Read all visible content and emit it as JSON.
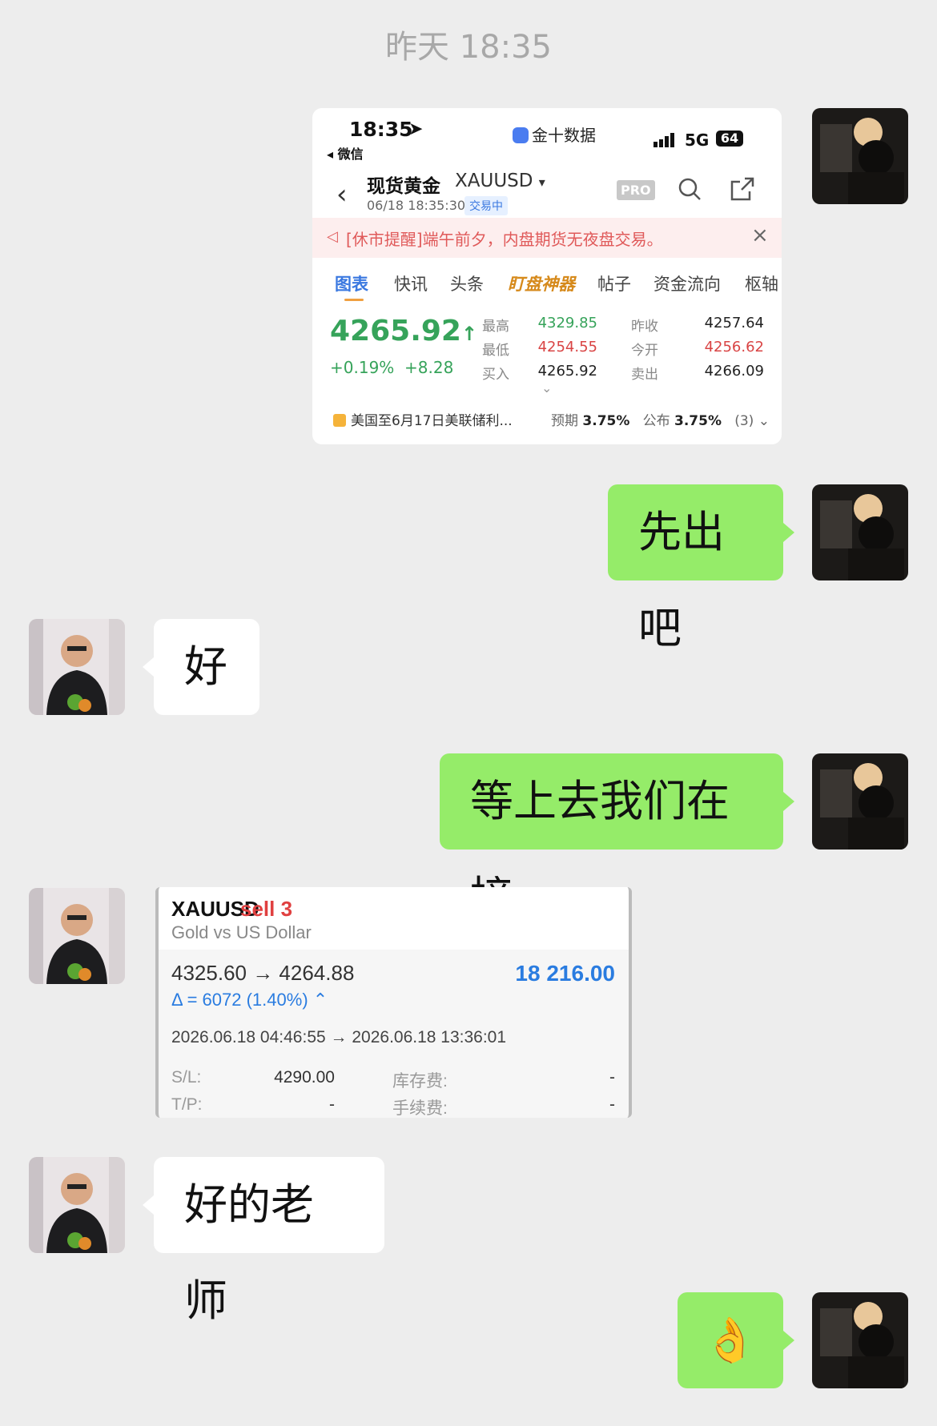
{
  "chat": {
    "timestamp": "昨天 18:35",
    "messages": [
      {
        "side": "right",
        "type": "image"
      },
      {
        "side": "right",
        "type": "text",
        "text": "先出吧"
      },
      {
        "side": "left",
        "type": "text",
        "text": "好"
      },
      {
        "side": "right",
        "type": "text",
        "text": "等上去我们在接"
      },
      {
        "side": "left",
        "type": "image"
      },
      {
        "side": "left",
        "type": "text",
        "text": "好的老师"
      },
      {
        "side": "right",
        "type": "emoji",
        "text": "👌"
      }
    ]
  },
  "screenshot": {
    "status": {
      "time": "18:35",
      "back_app": "◂ 微信",
      "app_name": "金十数据",
      "network": "5G",
      "battery": "64"
    },
    "header": {
      "title": "现货黄金",
      "code": "XAUUSD",
      "datetime": "06/18 18:35:30",
      "status_badge": "交易中",
      "pro_label": "PRO"
    },
    "notice": "[休市提醒]端午前夕，内盘期货无夜盘交易。",
    "tabs": [
      "图表",
      "快讯",
      "头条",
      "盯盘神器",
      "帖子",
      "资金流向",
      "枢轴"
    ],
    "quote": {
      "price": "4265.92",
      "change_pct": "+0.19%",
      "change_abs": "+8.28",
      "stats": [
        {
          "label": "最高",
          "value": "4329.85",
          "color": "green"
        },
        {
          "label": "昨收",
          "value": "4257.64",
          "color": "black"
        },
        {
          "label": "最低",
          "value": "4254.55",
          "color": "red"
        },
        {
          "label": "今开",
          "value": "4256.62",
          "color": "red"
        },
        {
          "label": "买入",
          "value": "4265.92",
          "color": "black"
        },
        {
          "label": "卖出",
          "value": "4266.09",
          "color": "black"
        }
      ]
    },
    "news": {
      "headline": "美国至6月17日美联储利...",
      "expected_label": "预期",
      "expected_value": "3.75%",
      "actual_label": "公布",
      "actual_value": "3.75%",
      "count": "(3)"
    }
  },
  "trade": {
    "symbol": "XAUUSD",
    "side": "sell 3",
    "description": "Gold vs US Dollar",
    "prices": "4325.60 → 4264.88",
    "profit": "18 216.00",
    "delta": "Δ = 6072 (1.40%) ⌃",
    "dates": "2026.06.18 04:46:55 → 2026.06.18 13:36:01",
    "sl_label": "S/L:",
    "sl_value": "4290.00",
    "tp_label": "T/P:",
    "tp_value": "-",
    "storage_label": "库存费:",
    "storage_value": "-",
    "fee_label": "手续费:",
    "fee_value": "-"
  },
  "colors": {
    "bg": "#ededed",
    "green_bubble": "#95ec69",
    "white_bubble": "#ffffff",
    "accent_blue": "#2a7ce0",
    "up_green": "#36a35a",
    "down_red": "#d94444"
  }
}
